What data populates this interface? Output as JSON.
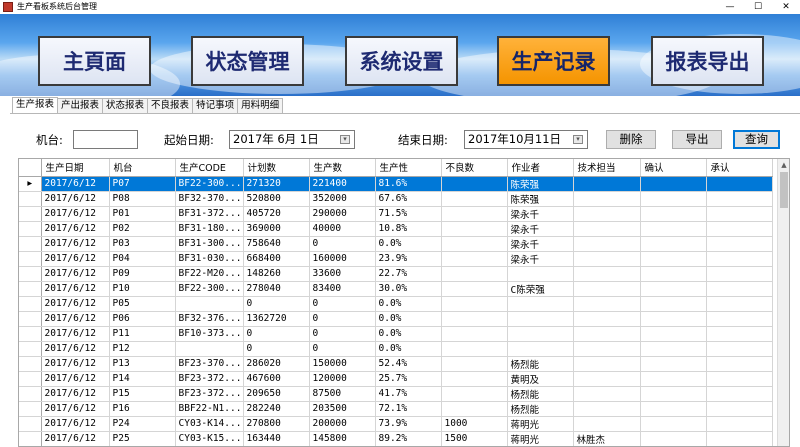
{
  "window": {
    "title": "生产看板系统后台管理",
    "minimize": "—",
    "maximize": "☐",
    "close": "✕"
  },
  "nav": [
    {
      "label": "主頁面",
      "active": false
    },
    {
      "label": "状态管理",
      "active": false
    },
    {
      "label": "系统设置",
      "active": false
    },
    {
      "label": "生产记录",
      "active": true
    },
    {
      "label": "报表导出",
      "active": false
    }
  ],
  "tabs": [
    "生产报表",
    "产出报表",
    "状态报表",
    "不良报表",
    "特记事项",
    "用料明细"
  ],
  "filter": {
    "machine_label": "机台:",
    "machine_value": "",
    "start_label": "起始日期:",
    "start_value": "2017年  6月  1日",
    "end_label": "结束日期:",
    "end_value": "2017年10月11日",
    "delete_label": "删除",
    "export_label": "导出",
    "query_label": "查询"
  },
  "grid": {
    "columns": [
      "生产日期",
      "机台",
      "生产CODE",
      "计划数",
      "生产数",
      "生产性",
      "不良数",
      "作业者",
      "技术担当",
      "确认",
      "承认"
    ],
    "current_row_marker": "▸",
    "rows": [
      [
        "2017/6/12",
        "P07",
        "BF22-300...",
        "271320",
        "221400",
        "81.6%",
        "",
        "陈荣强",
        "",
        "",
        ""
      ],
      [
        "2017/6/12",
        "P08",
        "BF32-370...",
        "520800",
        "352000",
        "67.6%",
        "",
        "陈荣强",
        "",
        "",
        ""
      ],
      [
        "2017/6/12",
        "P01",
        "BF31-372...",
        "405720",
        "290000",
        "71.5%",
        "",
        "梁永千",
        "",
        "",
        ""
      ],
      [
        "2017/6/12",
        "P02",
        "BF31-180...",
        "369000",
        "40000",
        "10.8%",
        "",
        "梁永千",
        "",
        "",
        ""
      ],
      [
        "2017/6/12",
        "P03",
        "BF31-300...",
        "758640",
        "0",
        "0.0%",
        "",
        "梁永千",
        "",
        "",
        ""
      ],
      [
        "2017/6/12",
        "P04",
        "BF31-030...",
        "668400",
        "160000",
        "23.9%",
        "",
        "梁永千",
        "",
        "",
        ""
      ],
      [
        "2017/6/12",
        "P09",
        "BF22-M20...",
        "148260",
        "33600",
        "22.7%",
        "",
        "",
        "",
        "",
        ""
      ],
      [
        "2017/6/12",
        "P10",
        "BF22-300...",
        "278040",
        "83400",
        "30.0%",
        "",
        "C陈荣强",
        "",
        "",
        ""
      ],
      [
        "2017/6/12",
        "P05",
        "",
        "0",
        "0",
        "0.0%",
        "",
        "",
        "",
        "",
        ""
      ],
      [
        "2017/6/12",
        "P06",
        "BF32-376...",
        "1362720",
        "0",
        "0.0%",
        "",
        "",
        "",
        "",
        ""
      ],
      [
        "2017/6/12",
        "P11",
        "BF10-373...",
        "0",
        "0",
        "0.0%",
        "",
        "",
        "",
        "",
        ""
      ],
      [
        "2017/6/12",
        "P12",
        "",
        "0",
        "0",
        "0.0%",
        "",
        "",
        "",
        "",
        ""
      ],
      [
        "2017/6/12",
        "P13",
        "BF23-370...",
        "286020",
        "150000",
        "52.4%",
        "",
        "杨烈能",
        "",
        "",
        ""
      ],
      [
        "2017/6/12",
        "P14",
        "BF23-372...",
        "467600",
        "120000",
        "25.7%",
        "",
        "黄明及",
        "",
        "",
        ""
      ],
      [
        "2017/6/12",
        "P15",
        "BF23-372...",
        "209650",
        "87500",
        "41.7%",
        "",
        "杨烈能",
        "",
        "",
        ""
      ],
      [
        "2017/6/12",
        "P16",
        "BBF22-N1...",
        "282240",
        "203500",
        "72.1%",
        "",
        "杨烈能",
        "",
        "",
        ""
      ],
      [
        "2017/6/12",
        "P24",
        "CY03-K14...",
        "270800",
        "200000",
        "73.9%",
        "1000",
        "蒋明光",
        "",
        "",
        ""
      ],
      [
        "2017/6/12",
        "P25",
        "CY03-K15...",
        "163440",
        "145800",
        "89.2%",
        "1500",
        "蒋明光",
        "林胜杰",
        "",
        ""
      ]
    ]
  },
  "colors": {
    "selected_row": "#0078d7",
    "active_nav": "#f59400",
    "nav_text": "#1e2a72"
  }
}
